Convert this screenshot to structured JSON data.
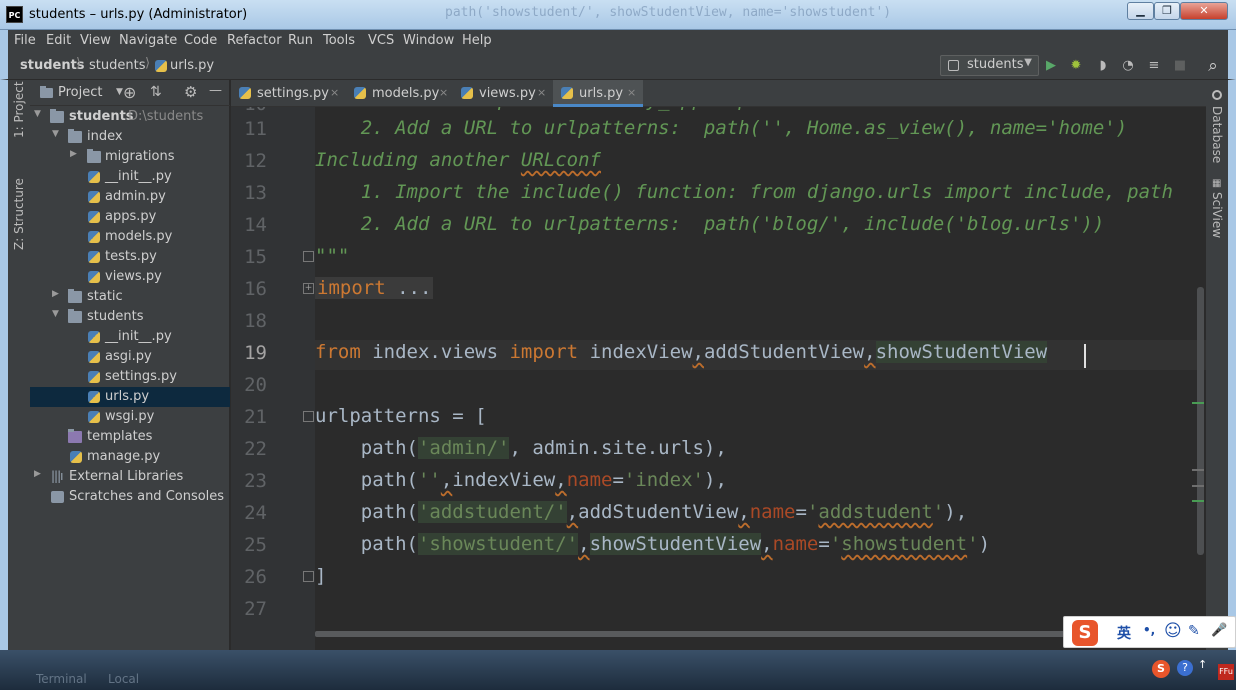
{
  "window": {
    "title": "students – urls.py (Administrator)",
    "app_icon_text": "PC",
    "ghost_text": "path('showstudent/', showStudentView, name='showstudent')",
    "min_label": "▁",
    "max_label": "❐",
    "close_label": "✕"
  },
  "menu": [
    "File",
    "Edit",
    "View",
    "Navigate",
    "Code",
    "Refactor",
    "Run",
    "Tools",
    "VCS",
    "Window",
    "Help"
  ],
  "breadcrumb": {
    "project": "students",
    "folder": "students",
    "file": "urls.py",
    "separator": "⟩"
  },
  "run_config": {
    "label": "students",
    "arrow": "▼"
  },
  "toolbar_icons": {
    "run": "▶",
    "debug": "✹",
    "coverage": "◗",
    "profile": "◔",
    "concurrency": "≡",
    "stop": "■",
    "search": "⌕"
  },
  "left_stripe": {
    "project_tab": "1: Project",
    "structure_tab": "Z: Structure"
  },
  "right_stripe": {
    "database_tab": "Database",
    "sciview_tab": "SciView"
  },
  "project_panel": {
    "title": "Project",
    "title_arrow": "▼",
    "icons": {
      "locate": "⊕",
      "collapse": "⇅",
      "settings": "⚙",
      "hide": "—"
    },
    "tree": [
      {
        "name": "students",
        "suffix": "D:\\students",
        "type": "folder",
        "level": 0,
        "expanded": true
      },
      {
        "name": "index",
        "type": "folder",
        "level": 1,
        "expanded": true
      },
      {
        "name": "migrations",
        "type": "folder",
        "level": 2,
        "expanded": false
      },
      {
        "name": "__init__.py",
        "type": "py",
        "level": 2
      },
      {
        "name": "admin.py",
        "type": "py",
        "level": 2
      },
      {
        "name": "apps.py",
        "type": "py",
        "level": 2
      },
      {
        "name": "models.py",
        "type": "py",
        "level": 2
      },
      {
        "name": "tests.py",
        "type": "py",
        "level": 2
      },
      {
        "name": "views.py",
        "type": "py",
        "level": 2
      },
      {
        "name": "static",
        "type": "folder",
        "level": 1,
        "expanded": false
      },
      {
        "name": "students",
        "type": "folder",
        "level": 1,
        "expanded": true
      },
      {
        "name": "__init__.py",
        "type": "py",
        "level": 2
      },
      {
        "name": "asgi.py",
        "type": "py",
        "level": 2
      },
      {
        "name": "settings.py",
        "type": "py",
        "level": 2
      },
      {
        "name": "urls.py",
        "type": "py",
        "level": 2,
        "selected": true
      },
      {
        "name": "wsgi.py",
        "type": "py",
        "level": 2
      },
      {
        "name": "templates",
        "type": "folder",
        "level": 1
      },
      {
        "name": "manage.py",
        "type": "py",
        "level": 1
      },
      {
        "name": "External Libraries",
        "type": "lib",
        "level": 0,
        "expanded": false
      },
      {
        "name": "Scratches and Consoles",
        "type": "scratch",
        "level": 0
      }
    ]
  },
  "tabs": [
    {
      "label": "settings.py",
      "active": false
    },
    {
      "label": "models.py",
      "active": false
    },
    {
      "label": "views.py",
      "active": false
    },
    {
      "label": "urls.py",
      "active": true
    }
  ],
  "tab_close": "×",
  "editor": {
    "line_numbers": [
      "11",
      "12",
      "13",
      "14",
      "15",
      "16",
      "18",
      "19",
      "20",
      "21",
      "22",
      "23",
      "24",
      "25",
      "26",
      "27"
    ],
    "current_line": "19"
  },
  "ime_bar": {
    "logo": "S",
    "lang": "英",
    "punct": "•,",
    "emoji": "☺",
    "skin": "✎",
    "mic": "🎤"
  },
  "taskbar": {
    "items": [
      "Terminal",
      "Local"
    ],
    "tray_ime": "S",
    "tray_help": "?",
    "tray_msg": "↑",
    "tray_fx": "FFu"
  },
  "colors": {
    "keyword": "#cc7832",
    "string": "#6a8759",
    "docstring": "#629755",
    "param": "#aa4926",
    "identifier": "#a9b7c6",
    "selection": "#0d293e",
    "tab_underline": "#4a88c7"
  }
}
